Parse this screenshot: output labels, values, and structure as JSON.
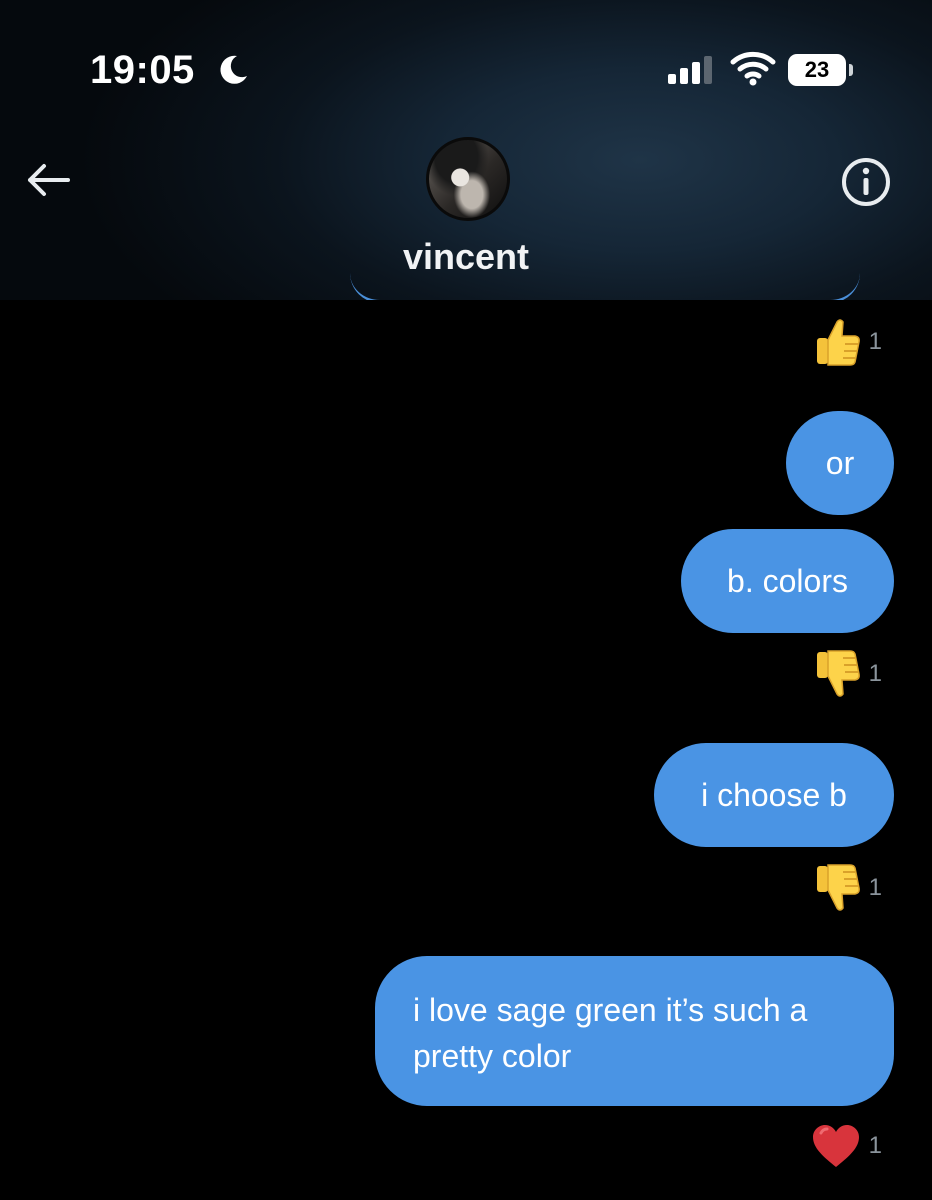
{
  "status_bar": {
    "time": "19:05",
    "battery_level": "23",
    "focus_icon": "moon-icon",
    "signal_icon": "cellular-signal-icon",
    "wifi_icon": "wifi-icon"
  },
  "header": {
    "contact_name": "vincent",
    "back_icon": "arrow-left-icon",
    "info_icon": "info-circle-icon"
  },
  "messages": [
    {
      "text": "or"
    },
    {
      "text": "b. colors",
      "reaction": {
        "icon": "thumbs-down-icon",
        "count": "1"
      }
    },
    {
      "text": "i choose b",
      "reaction": {
        "icon": "thumbs-down-icon",
        "count": "1"
      }
    },
    {
      "text": "i love sage green it’s such a pretty color",
      "reaction": {
        "icon": "heart-icon",
        "count": "1"
      }
    }
  ],
  "top_reaction": {
    "icon": "thumbs-up-icon",
    "count": "1"
  },
  "colors": {
    "bubble": "#4a94e4",
    "background": "#000000",
    "reaction_count": "#8b949c"
  }
}
